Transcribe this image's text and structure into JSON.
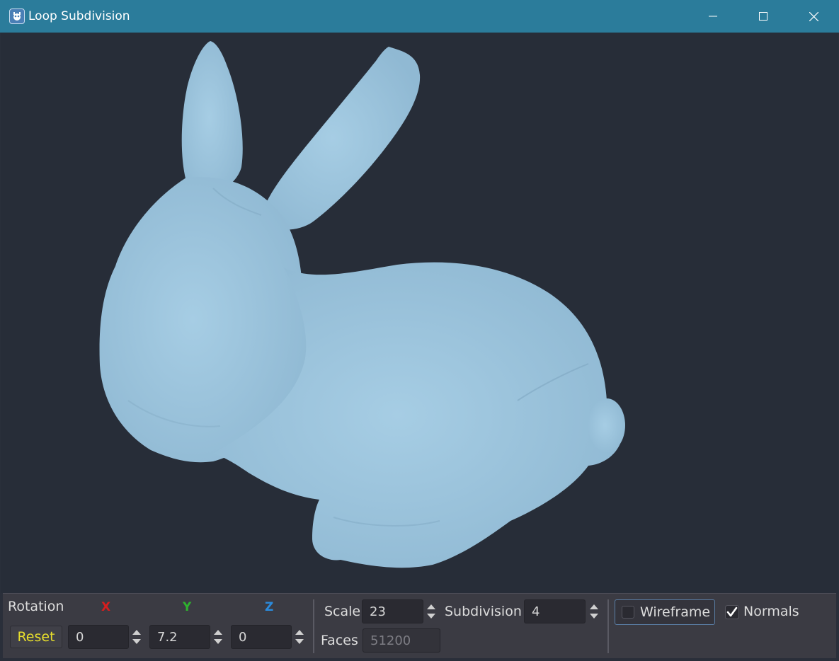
{
  "window": {
    "title": "Loop Subdivision"
  },
  "colors": {
    "titlebar": "#2b7c9b",
    "viewport_bg": "#272d38",
    "mesh": "#9cc4dc",
    "panel": "#3b3b43",
    "axis_x": "#d61e1e",
    "axis_y": "#2eb22e",
    "axis_z": "#2b8bdd",
    "reset_text": "#e8df2c"
  },
  "viewport": {
    "object_icon": "bunny-mesh"
  },
  "controls": {
    "rotation": {
      "label": "Rotation",
      "x_label": "X",
      "y_label": "Y",
      "z_label": "Z",
      "reset_label": "Reset",
      "x_value": "0",
      "y_value": "7.2",
      "z_value": "0"
    },
    "scale": {
      "label": "Scale",
      "value": "23"
    },
    "subdivision": {
      "label": "Subdivision",
      "value": "4"
    },
    "faces": {
      "label": "Faces",
      "value": "51200"
    },
    "wireframe": {
      "label": "Wireframe",
      "checked": false
    },
    "normals": {
      "label": "Normals",
      "checked": true
    }
  }
}
